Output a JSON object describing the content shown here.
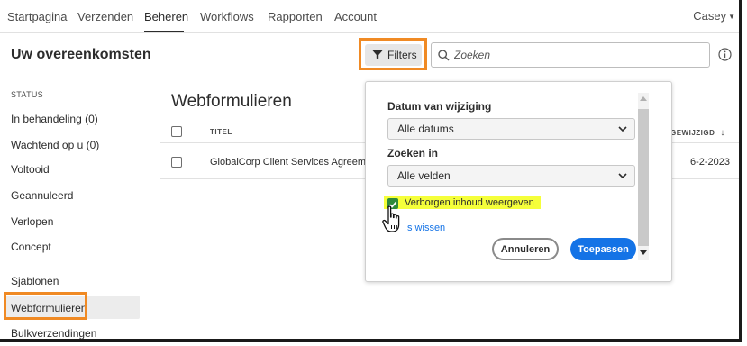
{
  "nav": {
    "items": [
      "Startpagina",
      "Verzenden",
      "Beheren",
      "Workflows",
      "Rapporten",
      "Account"
    ],
    "active": "Beheren",
    "user": "Casey"
  },
  "header": {
    "title": "Uw overeenkomsten",
    "filters_label": "Filters",
    "search_placeholder": "Zoeken"
  },
  "sidebar": {
    "heading": "STATUS",
    "items": [
      {
        "label": "In behandeling (0)"
      },
      {
        "label": "Wachtend op u (0)"
      },
      {
        "label": "Voltooid"
      },
      {
        "label": "Geannuleerd"
      },
      {
        "label": "Verlopen"
      },
      {
        "label": "Concept"
      },
      {
        "label": "Sjablonen"
      },
      {
        "label": "Webformulieren",
        "active": true
      },
      {
        "label": "Bulkverzendingen"
      }
    ]
  },
  "main": {
    "section_title": "Webformulieren",
    "columns": {
      "title": "TITEL",
      "modified": "GEWIJZIGD"
    },
    "rows": [
      {
        "title": "GlobalCorp Client Services Agreement",
        "modified": "6-2-2023"
      }
    ]
  },
  "filter_popover": {
    "date_label": "Datum van wijziging",
    "date_value": "Alle datums",
    "search_in_label": "Zoeken in",
    "search_in_value": "Alle velden",
    "show_hidden_label": "Verborgen inhoud weergeven",
    "show_hidden_checked": true,
    "clear_link": "s wissen",
    "cancel_label": "Annuleren",
    "apply_label": "Toepassen"
  },
  "colors": {
    "accent_blue": "#1473e6",
    "highlight_orange": "#f08a24",
    "highlight_yellow": "#f5ff3a",
    "checkbox_green": "#2e8b3a"
  },
  "icons": [
    "filter-icon",
    "search-icon",
    "info-icon",
    "chevron-down-icon",
    "sort-arrow-icon",
    "hand-cursor-icon"
  ]
}
